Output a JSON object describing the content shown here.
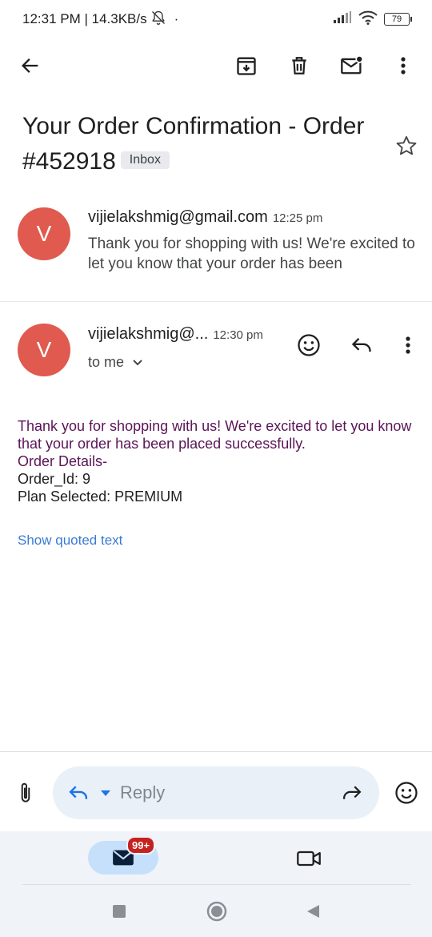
{
  "status_bar": {
    "time_speed": "12:31 PM | 14.3KB/s",
    "dot": "·",
    "battery": "79"
  },
  "toolbar": {
    "icons": [
      "back-arrow-icon",
      "archive-icon",
      "delete-icon",
      "mark-unread-icon",
      "more-vert-icon"
    ]
  },
  "subject": {
    "title": "Your Order Confirmation - Order #452918",
    "label": "Inbox"
  },
  "message_collapsed": {
    "avatar_letter": "V",
    "sender": "vijielakshmig@gmail.com",
    "time": "12:25 pm",
    "snippet": "Thank you for shopping with us! We're excited to let you know that your order has been"
  },
  "message_expanded": {
    "avatar_letter": "V",
    "sender": "vijielakshmig@...",
    "time": "12:30 pm",
    "to": "to me",
    "body": {
      "line1": "Thank you for shopping with us! We're excited to let you know that your order has been placed successfully.",
      "line2": "Order Details-",
      "line3": "Order_Id: 9",
      "line4": "Plan Selected: PREMIUM"
    },
    "show_quoted": "Show quoted text"
  },
  "reply_bar": {
    "placeholder": "Reply"
  },
  "bottom_nav": {
    "mail_badge": "99+"
  },
  "colors": {
    "avatar": "#e05a4f",
    "link": "#3a7bd5",
    "body_purple": "#5b1457",
    "reply_pill": "#e9f0f8",
    "nav_bg": "#f0f3f8",
    "badge": "#c5221f"
  }
}
